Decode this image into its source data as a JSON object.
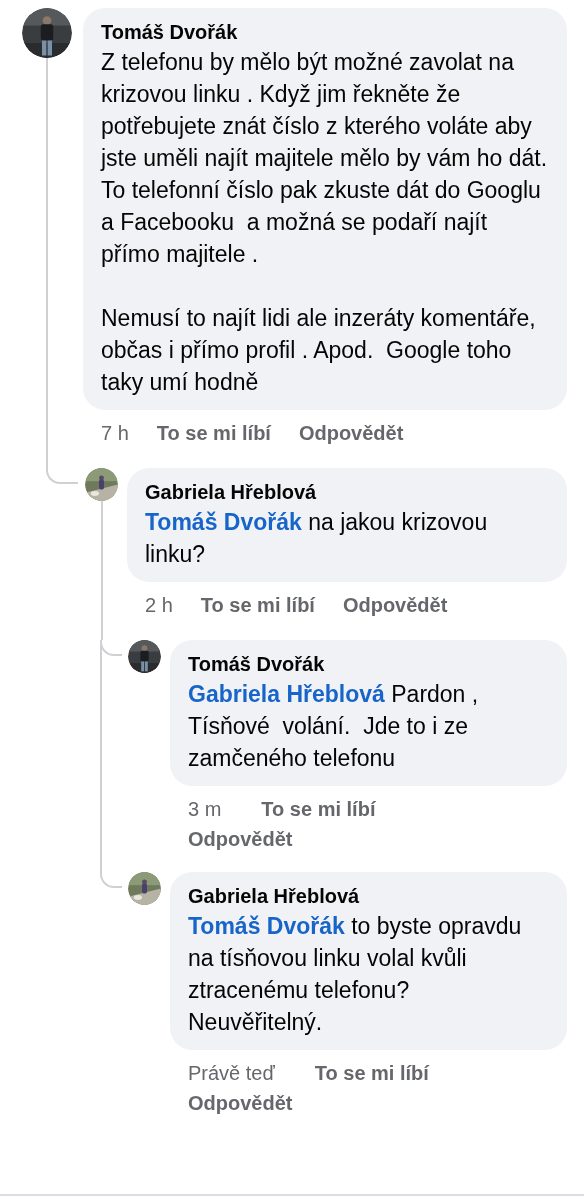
{
  "comments": [
    {
      "author": "Tomáš Dvořák",
      "avatar": {
        "kind": "picture"
      },
      "text": "Z telefonu by mělo být možné zavolat na krizovou linku . Když jim řekněte že potřebujete znát číslo z kterého voláte aby jste uměli najít majitele mělo by vám ho dát. To telefonní číslo pak zkuste dát do Googlu a Facebooku  a možná se podaří najít přímo majitele .\n\nNemusí to najít lidi ale inzeráty komentáře,  občas i přímo profil . Apod.  Google toho taky umí hodně",
      "time": "7 h",
      "like": "To se mi líbí",
      "reply": "Odpovědět",
      "replies": [
        {
          "author": "Gabriela Hřeblová",
          "avatar": {
            "kind": "picture"
          },
          "mention": "Tomáš Dvořák",
          "text": "na jakou krizovou linku?",
          "time": "2 h",
          "like": "To se mi líbí",
          "reply": "Odpovědět",
          "replies": [
            {
              "author": "Tomáš Dvořák",
              "avatar": {
                "kind": "picture"
              },
              "mention": "Gabriela Hřeblová",
              "text": "Pardon , Tísňové  volání.  Jde to i ze zamčeného telefonu",
              "time": "3 m",
              "like": "To se mi líbí",
              "reply": "Odpovědět"
            },
            {
              "author": "Gabriela Hřeblová",
              "avatar": {
                "kind": "picture"
              },
              "mention": "Tomáš Dvořák",
              "text": "to byste opravdu na tísňovou linku volal kvůli ztracenému telefonu? Neuvěřitelný.",
              "time": "Právě teď",
              "like": "To se mi líbí",
              "reply": "Odpovědět"
            }
          ]
        }
      ]
    }
  ]
}
